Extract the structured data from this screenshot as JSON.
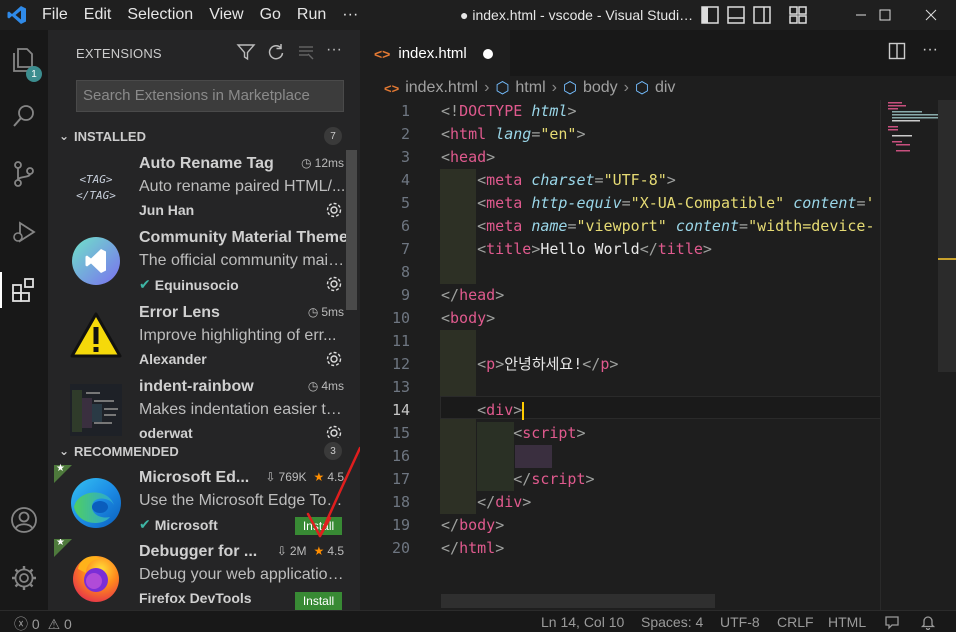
{
  "titlebar": {
    "menu": [
      "File",
      "Edit",
      "Selection",
      "View",
      "Go",
      "Run",
      "···"
    ],
    "title": "● index.html - vscode - Visual Studi…"
  },
  "activity": {
    "explorer_badge": "1"
  },
  "sidebar": {
    "header": "EXTENSIONS",
    "search_placeholder": "Search Extensions in Marketplace",
    "installed_label": "INSTALLED",
    "installed_count": "7",
    "recommended_label": "RECOMMENDED",
    "recommended_count": "3",
    "installed": [
      {
        "name": "Auto Rename Tag",
        "time": "12ms",
        "desc": "Auto rename paired HTML/...",
        "publisher": "Jun Han",
        "verified": false
      },
      {
        "name": "Community Material Theme",
        "time": "",
        "desc": "The official community main...",
        "publisher": "Equinusocio",
        "verified": true
      },
      {
        "name": "Error Lens",
        "time": "5ms",
        "desc": "Improve highlighting of err...",
        "publisher": "Alexander",
        "verified": false
      },
      {
        "name": "indent-rainbow",
        "time": "4ms",
        "desc": "Makes indentation easier to...",
        "publisher": "oderwat",
        "verified": false
      }
    ],
    "recommended": [
      {
        "name": "Microsoft Ed...",
        "downloads": "769K",
        "rating": "4.5",
        "desc": "Use the Microsoft Edge Tool...",
        "publisher": "Microsoft",
        "verified": true,
        "install": "Install"
      },
      {
        "name": "Debugger for ...",
        "downloads": "2M",
        "rating": "4.5",
        "desc": "Debug your web application...",
        "publisher": "Firefox DevTools",
        "verified": false,
        "install": "Install"
      }
    ]
  },
  "editor": {
    "tab_label": "index.html",
    "breadcrumb": [
      "index.html",
      "html",
      "body",
      "div"
    ],
    "current_line": 14,
    "lines": [
      "1",
      "2",
      "3",
      "4",
      "5",
      "6",
      "7",
      "8",
      "9",
      "10",
      "11",
      "12",
      "13",
      "14",
      "15",
      "16",
      "17",
      "18",
      "19",
      "20"
    ],
    "code": {
      "l1_a": "<!",
      "l1_b": "DOCTYPE",
      "l1_c": " html",
      "l1_d": ">",
      "l5_content": "X-UA-Compatible",
      "l6_content": "viewport",
      "l6_val": "\"width=device-",
      "l7_title": "Hello World",
      "l12_text": "안녕하세요!"
    }
  },
  "status": {
    "problems": "0",
    "warnings": "0",
    "position": "Ln 14, Col 10",
    "spaces": "Spaces: 4",
    "encoding": "UTF-8",
    "eol": "CRLF",
    "language": "HTML"
  },
  "colors": {
    "accent": "#3c8d8f",
    "install": "#388a34",
    "tag": "#e05a8e",
    "attr": "#9ad6e8",
    "string": "#e6db74"
  }
}
